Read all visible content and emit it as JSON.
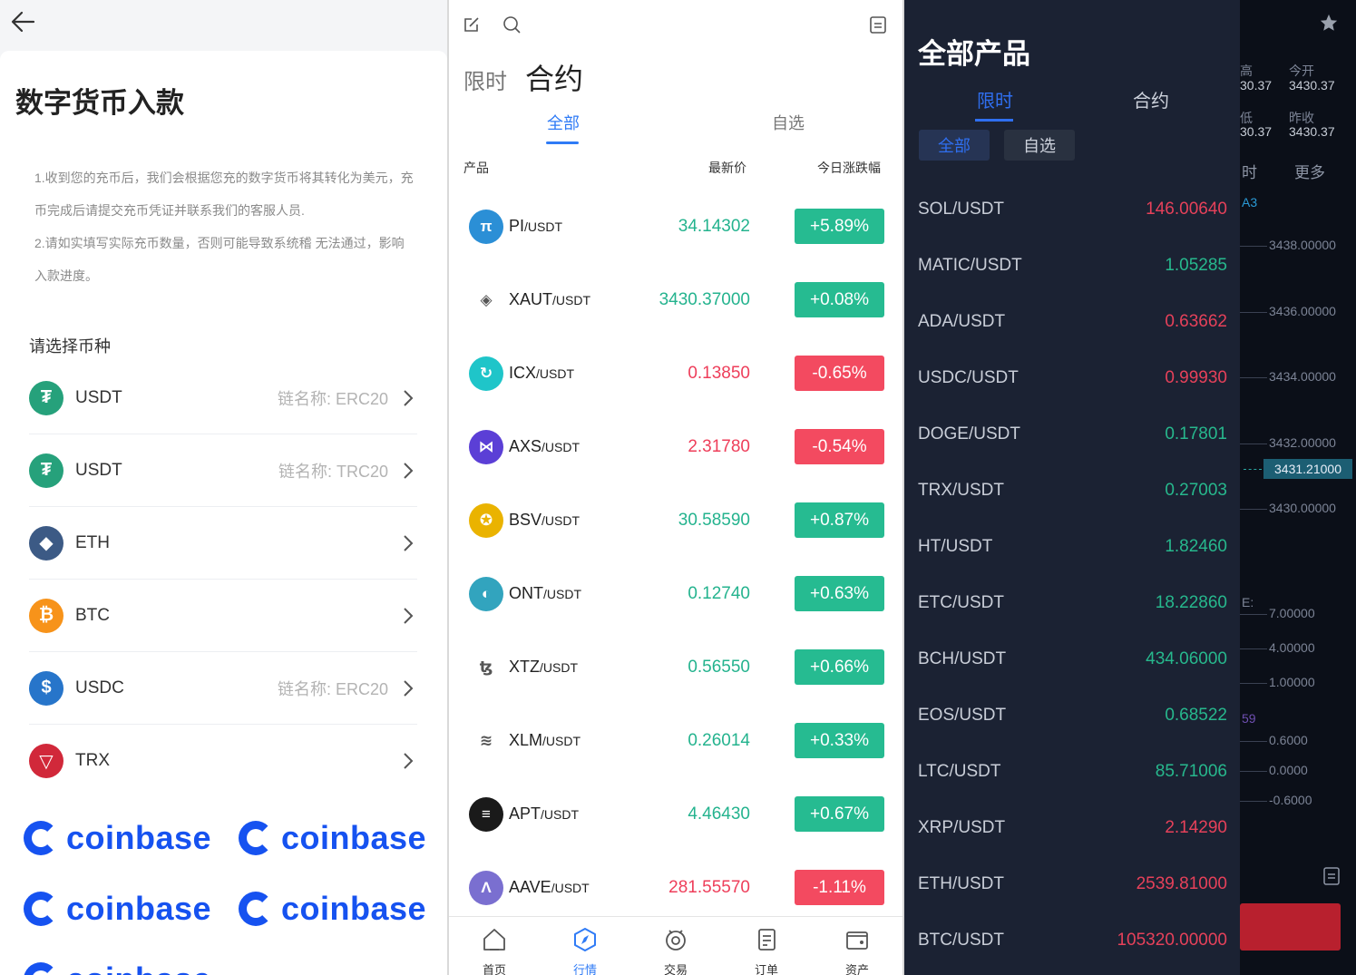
{
  "deposit": {
    "title": "数字货币入款",
    "notes": [
      "1.收到您的充币后，我们会根据您充的数字货币将其转化为美元，充币完成后请提交充币凭证并联系我们的客服人员.",
      "2.请如实填写实际充币数量，否则可能导致系统稽 无法通过，影响入款进度。"
    ],
    "select_label": "请选择币种",
    "coins": [
      {
        "name": "USDT",
        "chain": "链名称: ERC20",
        "color": "#26a17b",
        "symbol": "₮"
      },
      {
        "name": "USDT",
        "chain": "链名称: TRC20",
        "color": "#26a17b",
        "symbol": "₮"
      },
      {
        "name": "ETH",
        "chain": "",
        "color": "#3c5a85",
        "symbol": "◆"
      },
      {
        "name": "BTC",
        "chain": "",
        "color": "#f7931a",
        "symbol": "₿"
      },
      {
        "name": "USDC",
        "chain": "链名称: ERC20",
        "color": "#2775ca",
        "symbol": "$"
      },
      {
        "name": "TRX",
        "chain": "",
        "color": "#d1283a",
        "symbol": "▽"
      }
    ],
    "logo_text": "coinbase"
  },
  "market": {
    "tab_limit": "限时",
    "tab_contract": "合约",
    "sub_all": "全部",
    "sub_fav": "自选",
    "col_product": "产品",
    "col_price": "最新价",
    "col_change": "今日涨跌幅",
    "quote": "/USDT",
    "rows": [
      {
        "base": "PI",
        "price": "34.14302",
        "change": "+5.89%",
        "dir": "up",
        "color": "#2b8fd6",
        "glyph": "π"
      },
      {
        "base": "XAUT",
        "price": "3430.37000",
        "change": "+0.08%",
        "dir": "up",
        "color": "#ffffff",
        "glyph": "◈"
      },
      {
        "base": "ICX",
        "price": "0.13850",
        "change": "-0.65%",
        "dir": "dn",
        "color": "#1fc5c9",
        "glyph": "↻"
      },
      {
        "base": "AXS",
        "price": "2.31780",
        "change": "-0.54%",
        "dir": "dn",
        "color": "#5b3fd6",
        "glyph": "⋈"
      },
      {
        "base": "BSV",
        "price": "30.58590",
        "change": "+0.87%",
        "dir": "up",
        "color": "#eab300",
        "glyph": "✪"
      },
      {
        "base": "ONT",
        "price": "0.12740",
        "change": "+0.63%",
        "dir": "up",
        "color": "#32a4be",
        "glyph": "◐"
      },
      {
        "base": "XTZ",
        "price": "0.56550",
        "change": "+0.66%",
        "dir": "up",
        "color": "#ffffff",
        "glyph": "ꜩ"
      },
      {
        "base": "XLM",
        "price": "0.26014",
        "change": "+0.33%",
        "dir": "up",
        "color": "#ffffff",
        "glyph": "≋"
      },
      {
        "base": "APT",
        "price": "4.46430",
        "change": "+0.67%",
        "dir": "up",
        "color": "#1a1a1a",
        "glyph": "≡"
      },
      {
        "base": "AAVE",
        "price": "281.55570",
        "change": "-1.11%",
        "dir": "dn",
        "color": "#7a6fd0",
        "glyph": "Λ"
      }
    ],
    "tabbar": [
      {
        "label": "首页",
        "icon": "home-icon"
      },
      {
        "label": "行情",
        "icon": "compass-icon"
      },
      {
        "label": "交易",
        "icon": "trade-icon"
      },
      {
        "label": "订单",
        "icon": "orders-icon"
      },
      {
        "label": "资产",
        "icon": "wallet-icon"
      }
    ]
  },
  "dark": {
    "title": "全部产品",
    "tab_limit": "限时",
    "tab_contract": "合约",
    "pill_all": "全部",
    "pill_fav": "自选",
    "rows": [
      {
        "pair": "SOL/USDT",
        "price": "146.00640",
        "dir": "red"
      },
      {
        "pair": "MATIC/USDT",
        "price": "1.05285",
        "dir": "grn"
      },
      {
        "pair": "ADA/USDT",
        "price": "0.63662",
        "dir": "red"
      },
      {
        "pair": "USDC/USDT",
        "price": "0.99930",
        "dir": "red"
      },
      {
        "pair": "DOGE/USDT",
        "price": "0.17801",
        "dir": "grn"
      },
      {
        "pair": "TRX/USDT",
        "price": "0.27003",
        "dir": "grn"
      },
      {
        "pair": "HT/USDT",
        "price": "1.82460",
        "dir": "grn"
      },
      {
        "pair": "ETC/USDT",
        "price": "18.22860",
        "dir": "grn"
      },
      {
        "pair": "BCH/USDT",
        "price": "434.06000",
        "dir": "grn"
      },
      {
        "pair": "EOS/USDT",
        "price": "0.68522",
        "dir": "grn"
      },
      {
        "pair": "LTC/USDT",
        "price": "85.71006",
        "dir": "grn"
      },
      {
        "pair": "XRP/USDT",
        "price": "2.14290",
        "dir": "red"
      },
      {
        "pair": "ETH/USDT",
        "price": "2539.81000",
        "dir": "red"
      },
      {
        "pair": "BTC/USDT",
        "price": "105320.00000",
        "dir": "red"
      }
    ],
    "chart": {
      "high_label": "高",
      "high_val": "30.37",
      "open_label": "今开",
      "open_val": "3430.37",
      "low_label": "低",
      "low_val": "30.37",
      "prev_label": "昨收",
      "prev_val": "3430.37",
      "time_label": "时",
      "more_label": "更多",
      "ma_label": "A3",
      "vol_label": "E:",
      "macd_label": "59",
      "price_ticks": [
        "3438.00000",
        "3436.00000",
        "3434.00000",
        "3432.00000",
        "3430.00000"
      ],
      "current": "3431.21000",
      "vol_ticks": [
        "7.00000",
        "4.00000",
        "1.00000"
      ],
      "macd_ticks": [
        "0.6000",
        "0.0000",
        "-0.6000"
      ]
    }
  }
}
